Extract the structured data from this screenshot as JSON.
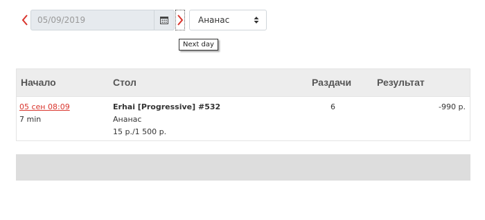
{
  "toolbar": {
    "date_value": "05/09/2019",
    "select_value": "Ананас",
    "next_tooltip": "Next day"
  },
  "colors": {
    "accent": "#d9332b",
    "header_bg": "#ededed",
    "input_bg": "#e6eaee"
  },
  "icons": {
    "prev": "chevron-left-icon",
    "next": "chevron-right-icon",
    "calendar": "calendar-icon",
    "select_caret": "sort-caret-icon"
  },
  "table": {
    "headers": {
      "start": "Начало",
      "table": "Стол",
      "hands": "Раздачи",
      "result": "Результат"
    },
    "rows": [
      {
        "start_link": "05 сен 08:09",
        "duration": "7 min",
        "table_name": "Erhai [Progressive] #532",
        "game": "Ананас",
        "stakes": "15 р./1 500 р.",
        "hands": "6",
        "result": "-990 р."
      }
    ]
  }
}
